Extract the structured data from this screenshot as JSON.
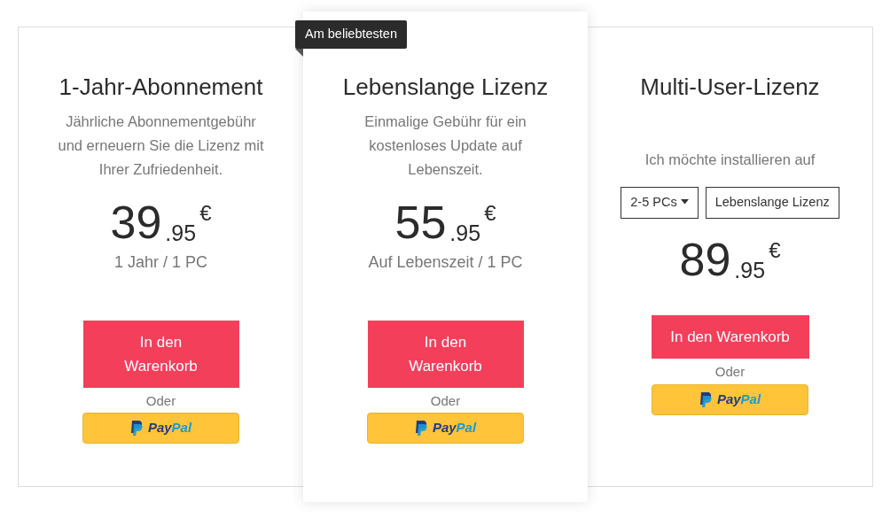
{
  "plans": [
    {
      "kind": "standard",
      "title": "1-Jahr-Abonnement",
      "description": "Jährliche Abonnementgebühr und erneuern Sie die Lizenz mit Ihrer Zufriedenheit.",
      "price": {
        "whole": "39",
        "cents": ".95",
        "currency": "€"
      },
      "term": "1 Jahr / 1 PC",
      "cart_button": "In den Warenkorb",
      "or_text": "Oder",
      "paypal": [
        "Pay",
        "Pal"
      ]
    },
    {
      "kind": "featured",
      "badge": "Am beliebtesten",
      "title": "Lebenslange Lizenz",
      "description": "Einmalige Gebühr für ein kostenloses Update auf Lebenszeit.",
      "price": {
        "whole": "55",
        "cents": ".95",
        "currency": "€"
      },
      "term": "Auf Lebenszeit / 1 PC",
      "cart_button": "In den Warenkorb",
      "or_text": "Oder",
      "paypal": [
        "Pay",
        "Pal"
      ]
    },
    {
      "kind": "multi",
      "title": "Multi-User-Lizenz",
      "prompt": "Ich möchte installieren auf",
      "device_select": "2-5 PCs",
      "license_option": "Lebenslange Lizenz",
      "price": {
        "whole": "89",
        "cents": ".95",
        "currency": "€"
      },
      "cart_button": "In den Warenkorb",
      "or_text": "Oder",
      "paypal": [
        "Pay",
        "Pal"
      ]
    }
  ]
}
